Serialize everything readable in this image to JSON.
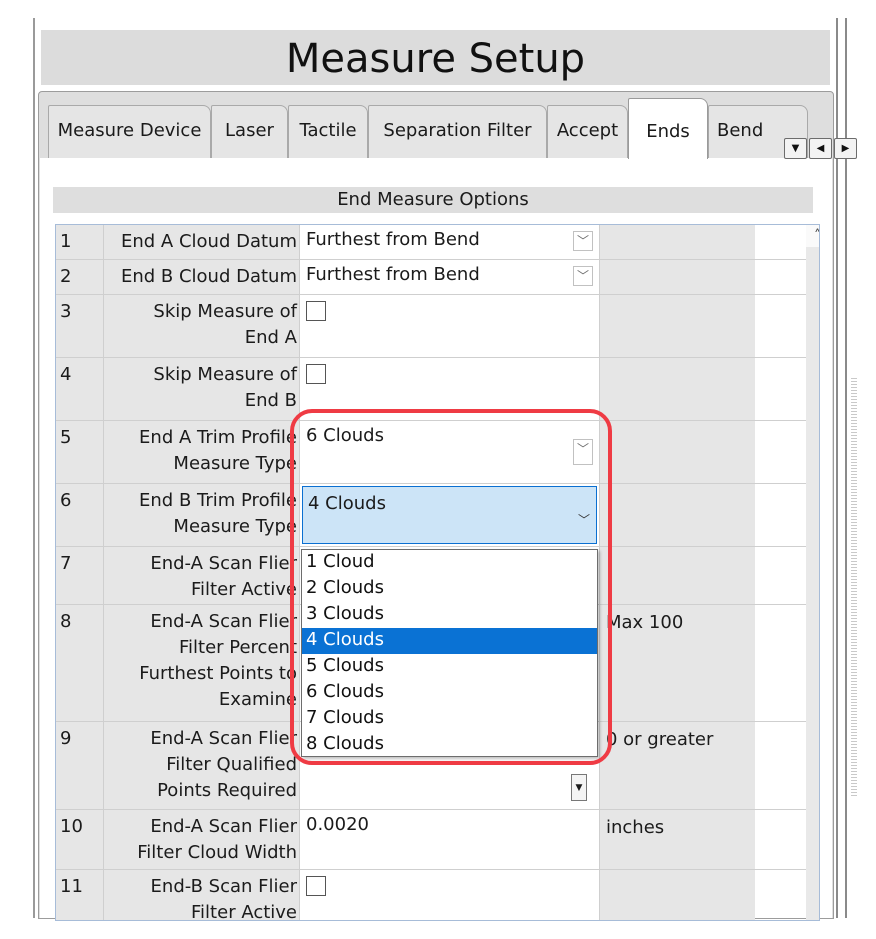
{
  "title": "Measure Setup",
  "tabs": [
    {
      "label": "Measure Device"
    },
    {
      "label": "Laser"
    },
    {
      "label": "Tactile"
    },
    {
      "label": "Separation Filter"
    },
    {
      "label": "Accept"
    },
    {
      "label": "Ends"
    },
    {
      "label": "Bend Profile"
    }
  ],
  "active_tab": "Ends",
  "section_header": "End Measure Options",
  "rows": [
    {
      "num": "1",
      "label": "End A Cloud Datum",
      "value": "Furthest from Bend",
      "unit": ""
    },
    {
      "num": "2",
      "label": "End B Cloud Datum",
      "value": "Furthest from Bend",
      "unit": ""
    },
    {
      "num": "3",
      "label": "Skip Measure of\nEnd A",
      "value": "",
      "unit": ""
    },
    {
      "num": "4",
      "label": "Skip Measure of\nEnd B",
      "value": "",
      "unit": ""
    },
    {
      "num": "5",
      "label": "End A Trim Profile\nMeasure Type",
      "value": "6 Clouds",
      "unit": ""
    },
    {
      "num": "6",
      "label": "End B Trim Profile\nMeasure Type",
      "value": "4 Clouds",
      "unit": ""
    },
    {
      "num": "7",
      "label": "End-A Scan Flier\nFilter Active",
      "value": "",
      "unit": ""
    },
    {
      "num": "8",
      "label": "End-A Scan Flier\nFilter Percent\nFurthest Points to\nExamine",
      "value": "",
      "unit": "Max 100"
    },
    {
      "num": "9",
      "label": "End-A Scan Flier\nFilter Qualified\nPoints Required",
      "value": "",
      "unit": "0 or greater"
    },
    {
      "num": "10",
      "label": "End-A Scan Flier\nFilter Cloud Width",
      "value": "0.0020",
      "unit": "inches"
    },
    {
      "num": "11",
      "label": "End-B Scan Flier\nFilter Active",
      "value": "",
      "unit": ""
    }
  ],
  "dropdown_options": [
    "1 Cloud",
    "2 Clouds",
    "3 Clouds",
    "4 Clouds",
    "5 Clouds",
    "6 Clouds",
    "7 Clouds",
    "8 Clouds"
  ],
  "dropdown_selected": "4 Clouds",
  "colors": {
    "selection": "#0a72d4",
    "highlight": "#ef3b44",
    "header_bg": "#dcdcdc"
  }
}
